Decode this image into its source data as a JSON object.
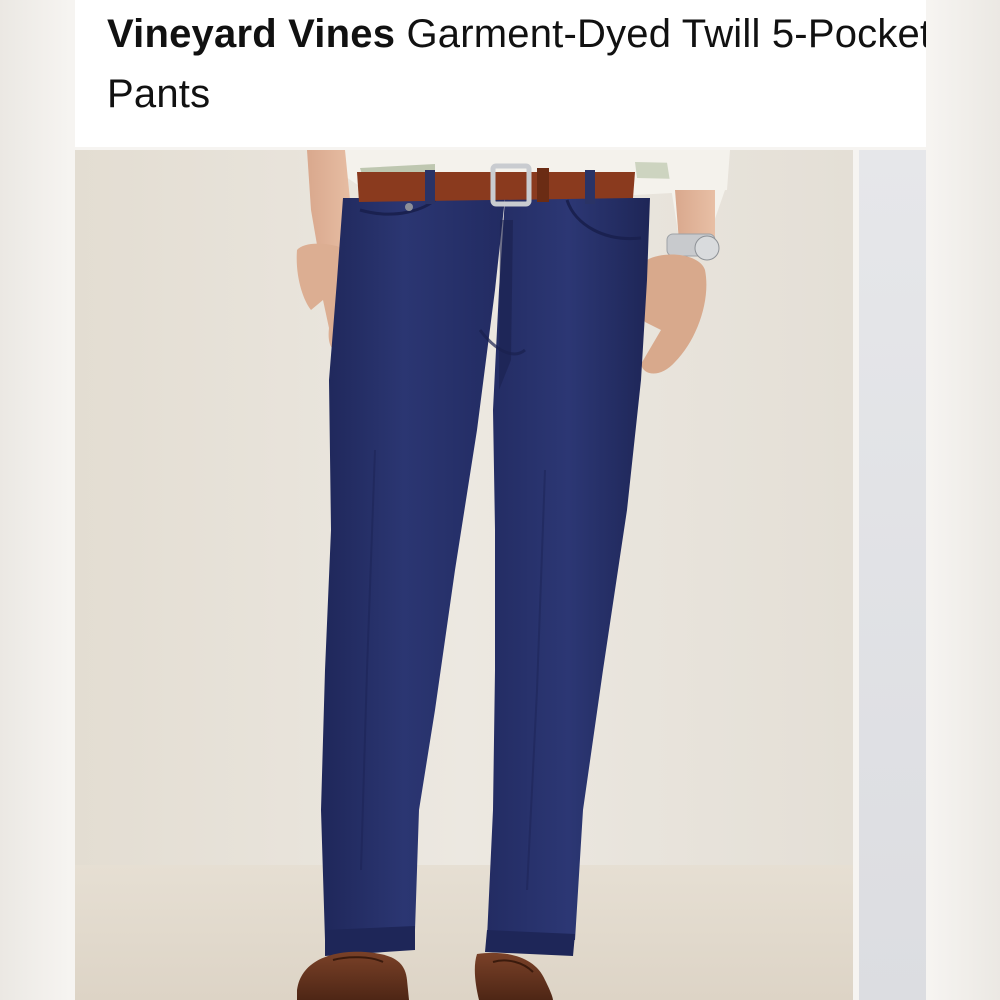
{
  "listing": {
    "brand": "Vineyard Vines",
    "title_line": "Garment-Dyed Twill 5-Pocket Pants"
  },
  "gallery": {
    "main_image": "navy-five-pocket-pants-photo",
    "next_image": "next-photo-peek"
  },
  "colors": {
    "pants": "#27316a",
    "belt": "#8a3a1e",
    "backdrop": "#e9e4dc"
  }
}
